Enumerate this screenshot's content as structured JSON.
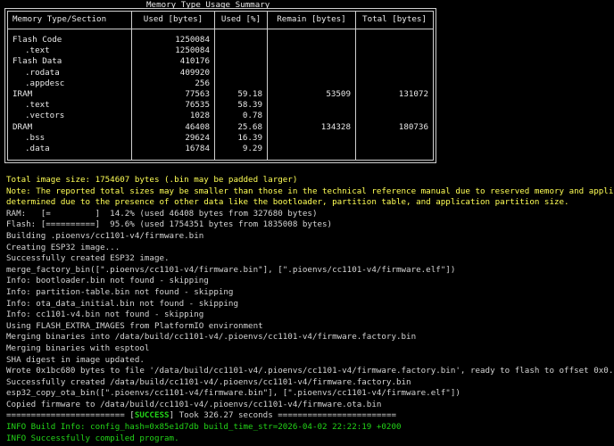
{
  "table": {
    "title": "Memory Type Usage Summary",
    "headers": [
      "Memory Type/Section",
      "Used [bytes]",
      "Used [%]",
      "Remain [bytes]",
      "Total [bytes]"
    ],
    "rows": [
      {
        "name": "Flash Code",
        "used": "1250084",
        "pct": "",
        "remain": "",
        "total": ""
      },
      {
        "name": ".text",
        "used": "1250084",
        "pct": "",
        "remain": "",
        "total": ""
      },
      {
        "name": "Flash Data",
        "used": "410176",
        "pct": "",
        "remain": "",
        "total": ""
      },
      {
        "name": ".rodata",
        "used": "409920",
        "pct": "",
        "remain": "",
        "total": ""
      },
      {
        "name": ".appdesc",
        "used": "256",
        "pct": "",
        "remain": "",
        "total": ""
      },
      {
        "name": "IRAM",
        "used": "77563",
        "pct": "59.18",
        "remain": "53509",
        "total": "131072"
      },
      {
        "name": ".text",
        "used": "76535",
        "pct": "58.39",
        "remain": "",
        "total": ""
      },
      {
        "name": ".vectors",
        "used": "1028",
        "pct": "0.78",
        "remain": "",
        "total": ""
      },
      {
        "name": "DRAM",
        "used": "46408",
        "pct": "25.68",
        "remain": "134328",
        "total": "180736"
      },
      {
        "name": ".bss",
        "used": "29624",
        "pct": "16.39",
        "remain": "",
        "total": ""
      },
      {
        "name": ".data",
        "used": "16784",
        "pct": "9.29",
        "remain": "",
        "total": ""
      }
    ]
  },
  "output": {
    "total_size": "Total image size: 1754607 bytes (.bin may be padded larger)",
    "note1": "Note: The reported total sizes may be smaller than those in the technical reference manual due to reserved memory and appli",
    "note2": "determined due to the presence of other data like the bootloader, partition table, and application partition size.",
    "ram": "RAM:   [=         ]  14.2% (used 46408 bytes from 327680 bytes)",
    "flash": "Flash: [==========]  95.6% (used 1754351 bytes from 1835008 bytes)",
    "building": "Building .pioenvs/cc1101-v4/firmware.bin",
    "creating": "Creating ESP32 image...",
    "created": "Successfully created ESP32 image.",
    "merge": "merge_factory_bin([\".pioenvs/cc1101-v4/firmware.bin\"], [\".pioenvs/cc1101-v4/firmware.elf\"])",
    "info_bootloader": "Info: bootloader.bin not found - skipping",
    "info_partition": "Info: partition-table.bin not found - skipping",
    "info_ota": "Info: ota_data_initial.bin not found - skipping",
    "info_cc1101": "Info: cc1101-v4.bin not found - skipping",
    "flash_extra": "Using FLASH_EXTRA_IMAGES from PlatformIO environment",
    "merging_into": "Merging binaries into /data/build/cc1101-v4/.pioenvs/cc1101-v4/firmware.factory.bin",
    "merging_esptool": "Merging binaries with esptool",
    "sha": "SHA digest in image updated.",
    "wrote": "Wrote 0x1bc680 bytes to file '/data/build/cc1101-v4/.pioenvs/cc1101-v4/firmware.factory.bin', ready to flash to offset 0x0.",
    "created_factory": "Successfully created /data/build/cc1101-v4/.pioenvs/cc1101-v4/firmware.factory.bin",
    "copy_ota": "esp32_copy_ota_bin([\".pioenvs/cc1101-v4/firmware.bin\"], [\".pioenvs/cc1101-v4/firmware.elf\"])",
    "copied": "Copied firmware to /data/build/cc1101-v4/.pioenvs/cc1101-v4/firmware.ota.bin",
    "sep_left": "======================== [",
    "success_word": "SUCCESS",
    "sep_right": "] Took 326.27 seconds ========================",
    "build_info": "INFO Build Info: config_hash=0x85e1d7db build_time_str=2026-04-02 22:22:19 +0200",
    "compiled": "INFO Successfully compiled program."
  },
  "colors": {
    "background": "#000000",
    "text": "#d4d4d4",
    "warning": "#ffff55",
    "success": "#23d418"
  }
}
